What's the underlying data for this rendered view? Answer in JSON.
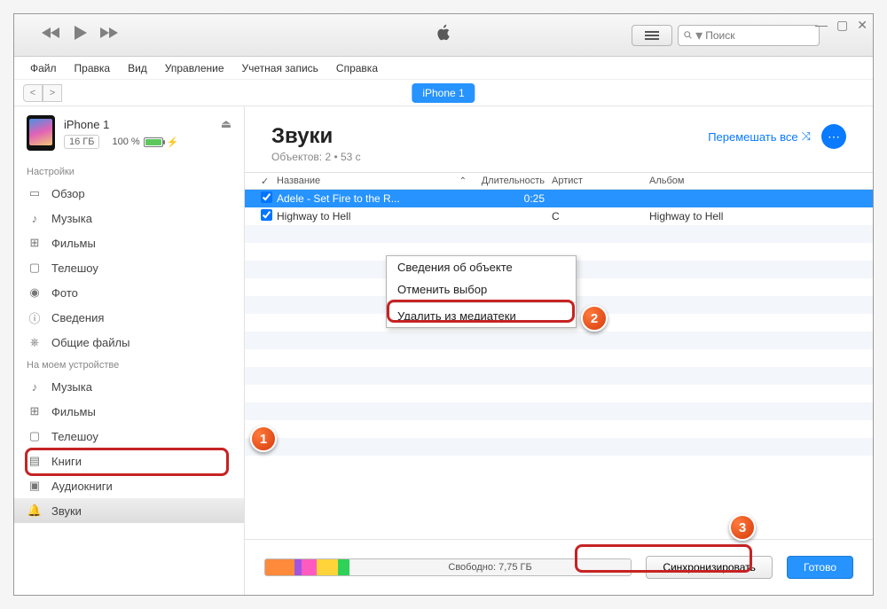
{
  "window": {
    "search_placeholder": "Поиск",
    "device_tab": "iPhone 1"
  },
  "menu": {
    "file": "Файл",
    "edit": "Правка",
    "view": "Вид",
    "controls": "Управление",
    "account": "Учетная запись",
    "help": "Справка"
  },
  "device": {
    "name": "iPhone 1",
    "capacity": "16 ГБ",
    "battery_text": "100 %"
  },
  "sidebar": {
    "settings_label": "Настройки",
    "settings": [
      {
        "label": "Обзор"
      },
      {
        "label": "Музыка"
      },
      {
        "label": "Фильмы"
      },
      {
        "label": "Телешоу"
      },
      {
        "label": "Фото"
      },
      {
        "label": "Сведения"
      },
      {
        "label": "Общие файлы"
      }
    ],
    "on_device_label": "На моем устройстве",
    "on_device": [
      {
        "label": "Музыка"
      },
      {
        "label": "Фильмы"
      },
      {
        "label": "Телешоу"
      },
      {
        "label": "Книги"
      },
      {
        "label": "Аудиокниги"
      },
      {
        "label": "Звуки"
      }
    ]
  },
  "content": {
    "title": "Звуки",
    "subtitle": "Объектов: 2 • 53 с",
    "shuffle": "Перемешать все",
    "columns": {
      "name": "Название",
      "duration": "Длительность",
      "artist": "Артист",
      "album": "Альбом"
    },
    "rows": [
      {
        "name": "Adele - Set Fire to the R...",
        "duration": "0:25",
        "artist": "",
        "album": ""
      },
      {
        "name": "Highway to Hell",
        "duration": "",
        "artist": "C",
        "album": "Highway to Hell"
      }
    ]
  },
  "context_menu": {
    "info": "Сведения об объекте",
    "deselect": "Отменить выбор",
    "delete": "Удалить из медиатеки"
  },
  "footer": {
    "free": "Свободно: 7,75 ГБ",
    "sync": "Синхронизировать",
    "done": "Готово"
  },
  "annotations": {
    "n1": "1",
    "n2": "2",
    "n3": "3"
  }
}
